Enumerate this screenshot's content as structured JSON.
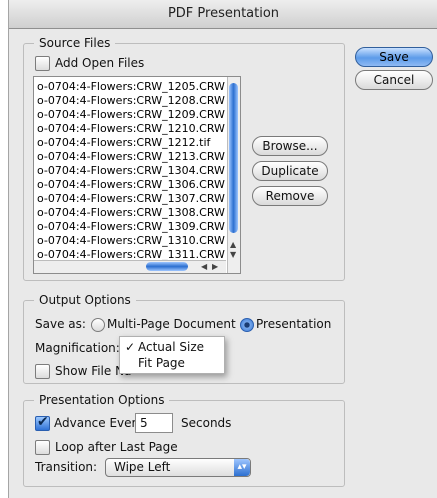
{
  "window": {
    "title": "PDF Presentation"
  },
  "buttons": {
    "save": "Save",
    "cancel": "Cancel",
    "browse": "Browse...",
    "duplicate": "Duplicate",
    "remove": "Remove"
  },
  "source_files": {
    "title": "Source Files",
    "add_open_files": {
      "label": "Add Open Files",
      "checked": false
    },
    "items": [
      "o-0704:4-Flowers:CRW_1205.CRW",
      "o-0704:4-Flowers:CRW_1208.CRW",
      "o-0704:4-Flowers:CRW_1209.CRW",
      "o-0704:4-Flowers:CRW_1210.CRW",
      "o-0704:4-Flowers:CRW_1212.tif",
      "o-0704:4-Flowers:CRW_1213.CRW",
      "o-0704:4-Flowers:CRW_1304.CRW",
      "o-0704:4-Flowers:CRW_1306.CRW",
      "o-0704:4-Flowers:CRW_1307.CRW",
      "o-0704:4-Flowers:CRW_1308.CRW",
      "o-0704:4-Flowers:CRW_1309.CRW",
      "o-0704:4-Flowers:CRW_1310.CRW",
      "o-0704:4-Flowers:CRW_1311.CRW"
    ]
  },
  "output_options": {
    "title": "Output Options",
    "save_as_label": "Save as:",
    "multi_page": "Multi-Page Document",
    "presentation": "Presentation",
    "selected": "presentation",
    "magnification_label": "Magnification:",
    "magnification_menu": {
      "check": "✓",
      "options": [
        "Actual Size",
        "Fit Page"
      ],
      "selected": "Actual Size"
    },
    "show_filename_label": "Show File Na",
    "show_filename_checked": false
  },
  "presentation_options": {
    "title": "Presentation Options",
    "advance_every_label": "Advance Every",
    "advance_every_checked": true,
    "seconds_value": "5",
    "seconds_label": "Seconds",
    "loop_label": "Loop after Last Page",
    "loop_checked": false,
    "transition_label": "Transition:",
    "transition_value": "Wipe Left"
  },
  "icons": {
    "checkmark": "checkmark-icon",
    "scroll_arrows": "scroll-arrow-icon",
    "select_arrows": "updown-arrow-icon"
  }
}
